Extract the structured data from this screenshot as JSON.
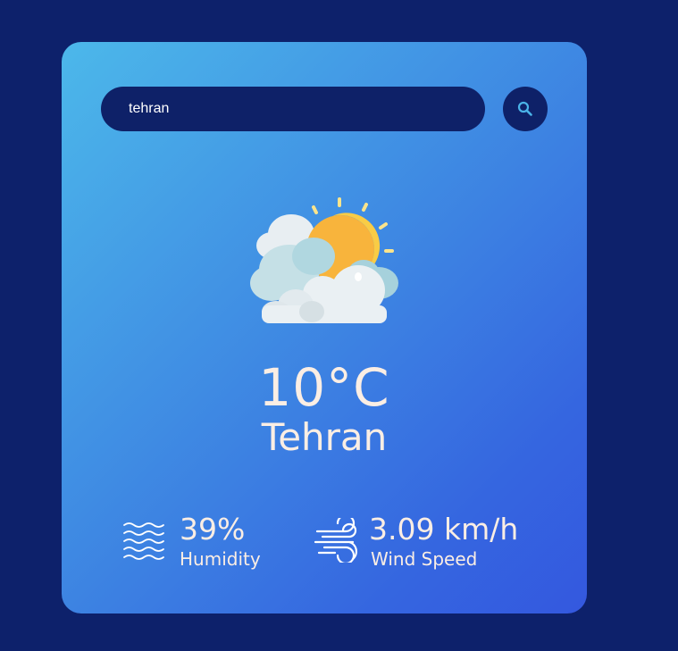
{
  "search": {
    "value": "tehran",
    "button_icon": "search-icon"
  },
  "weather": {
    "icon": "partly-cloudy-sun-icon",
    "temperature": "10°C",
    "city": "Tehran"
  },
  "stats": {
    "humidity": {
      "icon": "humidity-waves-icon",
      "value": "39%",
      "label": "Humidity"
    },
    "wind": {
      "icon": "wind-icon",
      "value": "3.09 km/h",
      "label": "Wind Speed"
    }
  },
  "colors": {
    "page_background": "#0d216b",
    "card_gradient_start": "#4cb8ea",
    "card_gradient_end": "#3458df",
    "input_background": "#0e2168",
    "text": "#fbeee4",
    "search_icon": "#4ab3e8"
  }
}
